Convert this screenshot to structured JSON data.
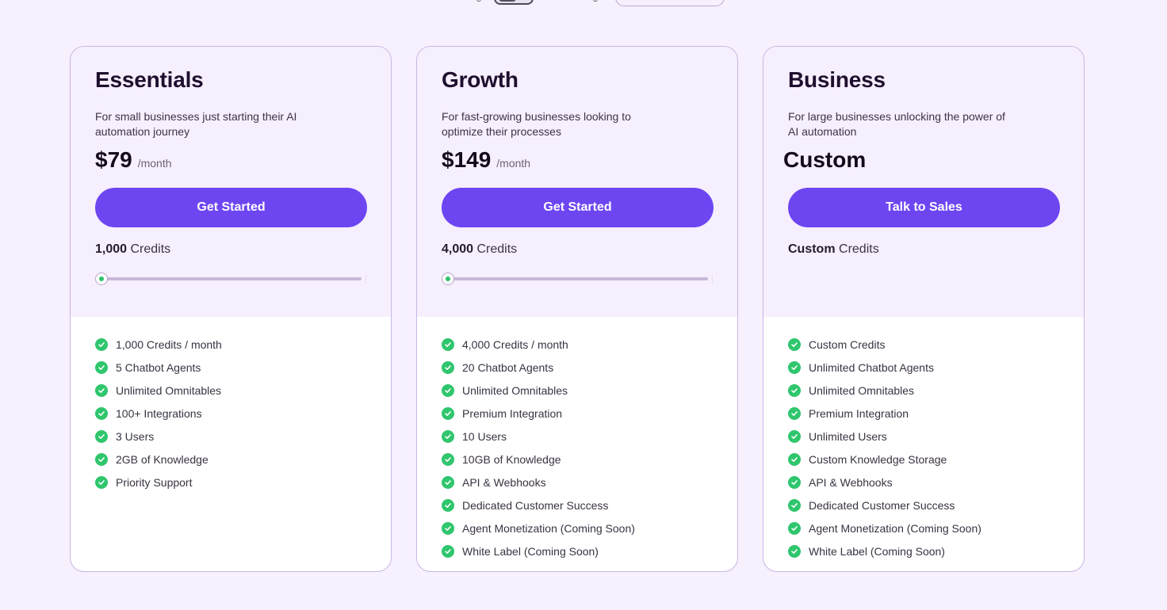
{
  "plans": [
    {
      "name": "Essentials",
      "description": "For small businesses just starting their AI automation journey",
      "price": "$79",
      "period": "/month",
      "cta": "Get Started",
      "credits_value": "1,000",
      "credits_label": "Credits",
      "slider_position": 0,
      "features": [
        "1,000 Credits / month",
        "5 Chatbot Agents",
        "Unlimited Omnitables",
        "100+ Integrations",
        "3 Users",
        "2GB of Knowledge",
        "Priority Support"
      ]
    },
    {
      "name": "Growth",
      "description": "For fast-growing businesses looking to optimize their processes",
      "price": "$149",
      "period": "/month",
      "cta": "Get Started",
      "credits_value": "4,000",
      "credits_label": "Credits",
      "slider_position": 0,
      "features": [
        "4,000 Credits / month",
        "20 Chatbot Agents",
        "Unlimited Omnitables",
        "Premium Integration",
        "10 Users",
        "10GB of Knowledge",
        "API & Webhooks",
        "Dedicated Customer Success",
        "Agent Monetization (Coming Soon)",
        "White Label (Coming Soon)"
      ]
    },
    {
      "name": "Business",
      "description": "For large businesses unlocking the power of AI automation",
      "price": "Custom",
      "cta": "Talk to Sales",
      "credits_value": "Custom",
      "credits_label": "Credits",
      "features": [
        "Custom Credits",
        "Unlimited Chatbot Agents",
        "Unlimited Omnitables",
        "Premium Integration",
        "Unlimited Users",
        "Custom Knowledge Storage",
        "API & Webhooks",
        "Dedicated Customer Success",
        "Agent Monetization (Coming Soon)",
        "White Label (Coming Soon)"
      ]
    }
  ],
  "colors": {
    "page_bg": "#f7f0fd",
    "card_top_bg": "#f6effd",
    "accent": "#6d46f2",
    "check_green": "#2fc66d",
    "border": "#c9b6e6"
  },
  "icons": {
    "check": "check-circle-icon"
  }
}
